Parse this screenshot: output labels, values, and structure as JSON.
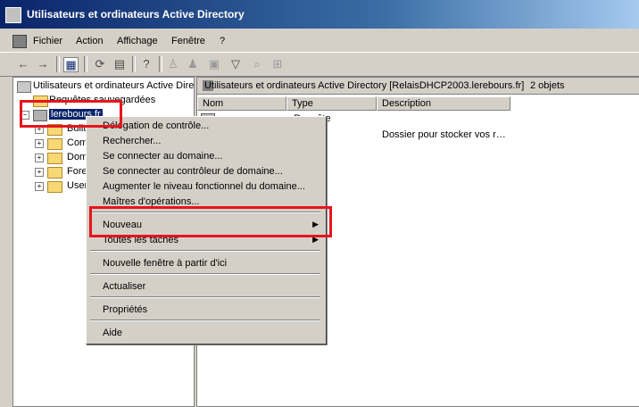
{
  "window": {
    "title": "Utilisateurs et ordinateurs Active Directory"
  },
  "menubar": {
    "items": [
      "Fichier",
      "Action",
      "Affichage",
      "Fenêtre",
      "?"
    ]
  },
  "toolbar": {
    "icons": [
      "back-arrow",
      "forward-arrow",
      "console-tree",
      "refresh",
      "export",
      "help",
      "new-user",
      "new-group",
      "new-ou",
      "filter",
      "find",
      "add-to-group"
    ]
  },
  "tree": {
    "root": "Utilisateurs et ordinateurs Active Dire",
    "saved_queries": "Requêtes sauvegardées",
    "domain": "lerebours.fr",
    "children": [
      "Builtin",
      "Com",
      "Dom",
      "Fore",
      "User"
    ]
  },
  "details": {
    "header": "Utilisateurs et ordinateurs Active Directory [RelaisDHCP2003.lerebours.fr]",
    "count": "2 objets",
    "columns": [
      "Nom",
      "Type",
      "Description"
    ],
    "rows": [
      {
        "name": "",
        "type": "Requête",
        "description": ""
      },
      {
        "name": "",
        "type": "",
        "description": "Dossier pour stocker vos r…"
      }
    ]
  },
  "context_menu": {
    "items": [
      "Délégation de contrôle...",
      "Rechercher...",
      "Se connecter au domaine...",
      "Se connecter au contrôleur de domaine...",
      "Augmenter le niveau fonctionnel du domaine...",
      "Maîtres d'opérations...",
      "Nouveau",
      "Toutes les tâches",
      "Nouvelle fenêtre à partir d'ici",
      "Actualiser",
      "Propriétés",
      "Aide"
    ]
  },
  "colors": {
    "highlight": "#e8141c",
    "titlebar": "#0a246a",
    "selection": "#0a246a"
  }
}
